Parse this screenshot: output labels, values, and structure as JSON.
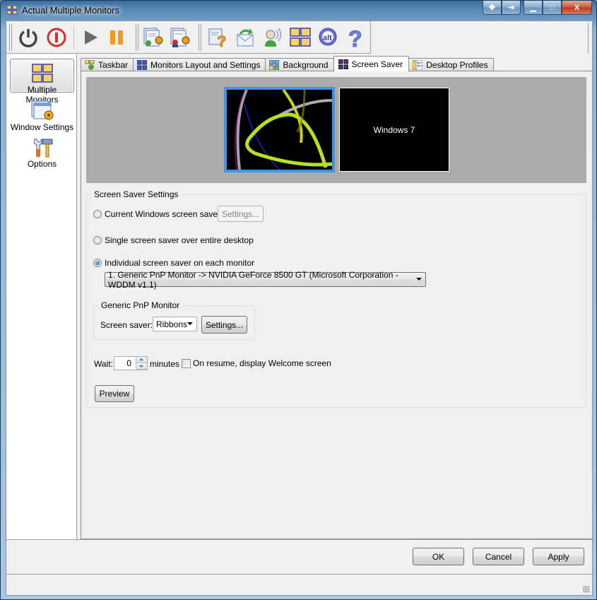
{
  "window": {
    "title": "Actual Multiple Monitors",
    "caption_buttons": [
      {
        "name": "move-icon",
        "glyph": "✥"
      },
      {
        "name": "pin-icon",
        "glyph": "⇥"
      },
      {
        "name": "minimize-icon",
        "glyph": "▁"
      },
      {
        "name": "maximize-icon",
        "glyph": "□"
      },
      {
        "name": "close-icon",
        "glyph": "X"
      }
    ]
  },
  "toolbar": {
    "buttons": [
      {
        "name": "power-on-icon",
        "tooltip": "Enable"
      },
      {
        "name": "power-off-icon",
        "tooltip": "Disable"
      },
      {
        "name": "play-icon",
        "tooltip": "Start"
      },
      {
        "name": "pause-icon",
        "tooltip": "Pause"
      },
      {
        "name": "user-settings-icon",
        "tooltip": "User settings"
      },
      {
        "name": "admin-settings-icon",
        "tooltip": "Admin settings"
      },
      {
        "name": "help-document-icon",
        "tooltip": "Help"
      },
      {
        "name": "send-mail-icon",
        "tooltip": "Send feedback"
      },
      {
        "name": "support-icon",
        "tooltip": "Support"
      },
      {
        "name": "monitors-icon",
        "tooltip": "Monitors"
      },
      {
        "name": "actual-tools-icon",
        "tooltip": "Actual Tools"
      },
      {
        "name": "about-icon",
        "tooltip": "About"
      }
    ]
  },
  "sidebar": {
    "items": [
      {
        "label": "Multiple Monitors",
        "icon": "multiple-monitors-icon",
        "active": true
      },
      {
        "label": "Window Settings",
        "icon": "window-settings-icon",
        "active": false
      },
      {
        "label": "Options",
        "icon": "options-icon",
        "active": false
      }
    ]
  },
  "tabs": [
    {
      "label": "Taskbar",
      "icon": "taskbar-icon",
      "active": false
    },
    {
      "label": "Monitors Layout and Settings",
      "icon": "monitors-layout-icon",
      "active": false
    },
    {
      "label": "Background",
      "icon": "background-icon",
      "active": false
    },
    {
      "label": "Screen Saver",
      "icon": "screen-saver-icon",
      "active": true
    },
    {
      "label": "Desktop Profiles",
      "icon": "desktop-profiles-icon",
      "active": false
    }
  ],
  "preview": {
    "monitors": [
      {
        "label": "",
        "selected": true,
        "content": "Ribbons screen saver preview"
      },
      {
        "label": "Windows 7",
        "selected": false
      }
    ],
    "selected_border_color": "#3d95ea"
  },
  "screensaver": {
    "group_label": "Screen Saver Settings",
    "options": [
      {
        "label": "Current Windows screen saver",
        "checked": false
      },
      {
        "label": "Single screen saver over entire desktop",
        "checked": false
      },
      {
        "label": "Individual screen saver on each monitor",
        "checked": true
      }
    ],
    "current_settings_button": "Settings...",
    "monitor_select": "1. Generic PnP Monitor -> NVIDIA GeForce 8500 GT (Microsoft Corporation - WDDM v1.1)",
    "monitor_group_label": "Generic PnP Monitor",
    "screensaver_label": "Screen saver:",
    "screensaver_value": "Ribbons",
    "monitor_settings_button": "Settings...",
    "wait_label": "Wait:",
    "wait_value": "0",
    "minutes_label": "minutes",
    "resume_label": "On resume, display Welcome screen",
    "resume_checked": false,
    "preview_button": "Preview"
  },
  "footer": {
    "ok": "OK",
    "cancel": "Cancel",
    "apply": "Apply"
  }
}
